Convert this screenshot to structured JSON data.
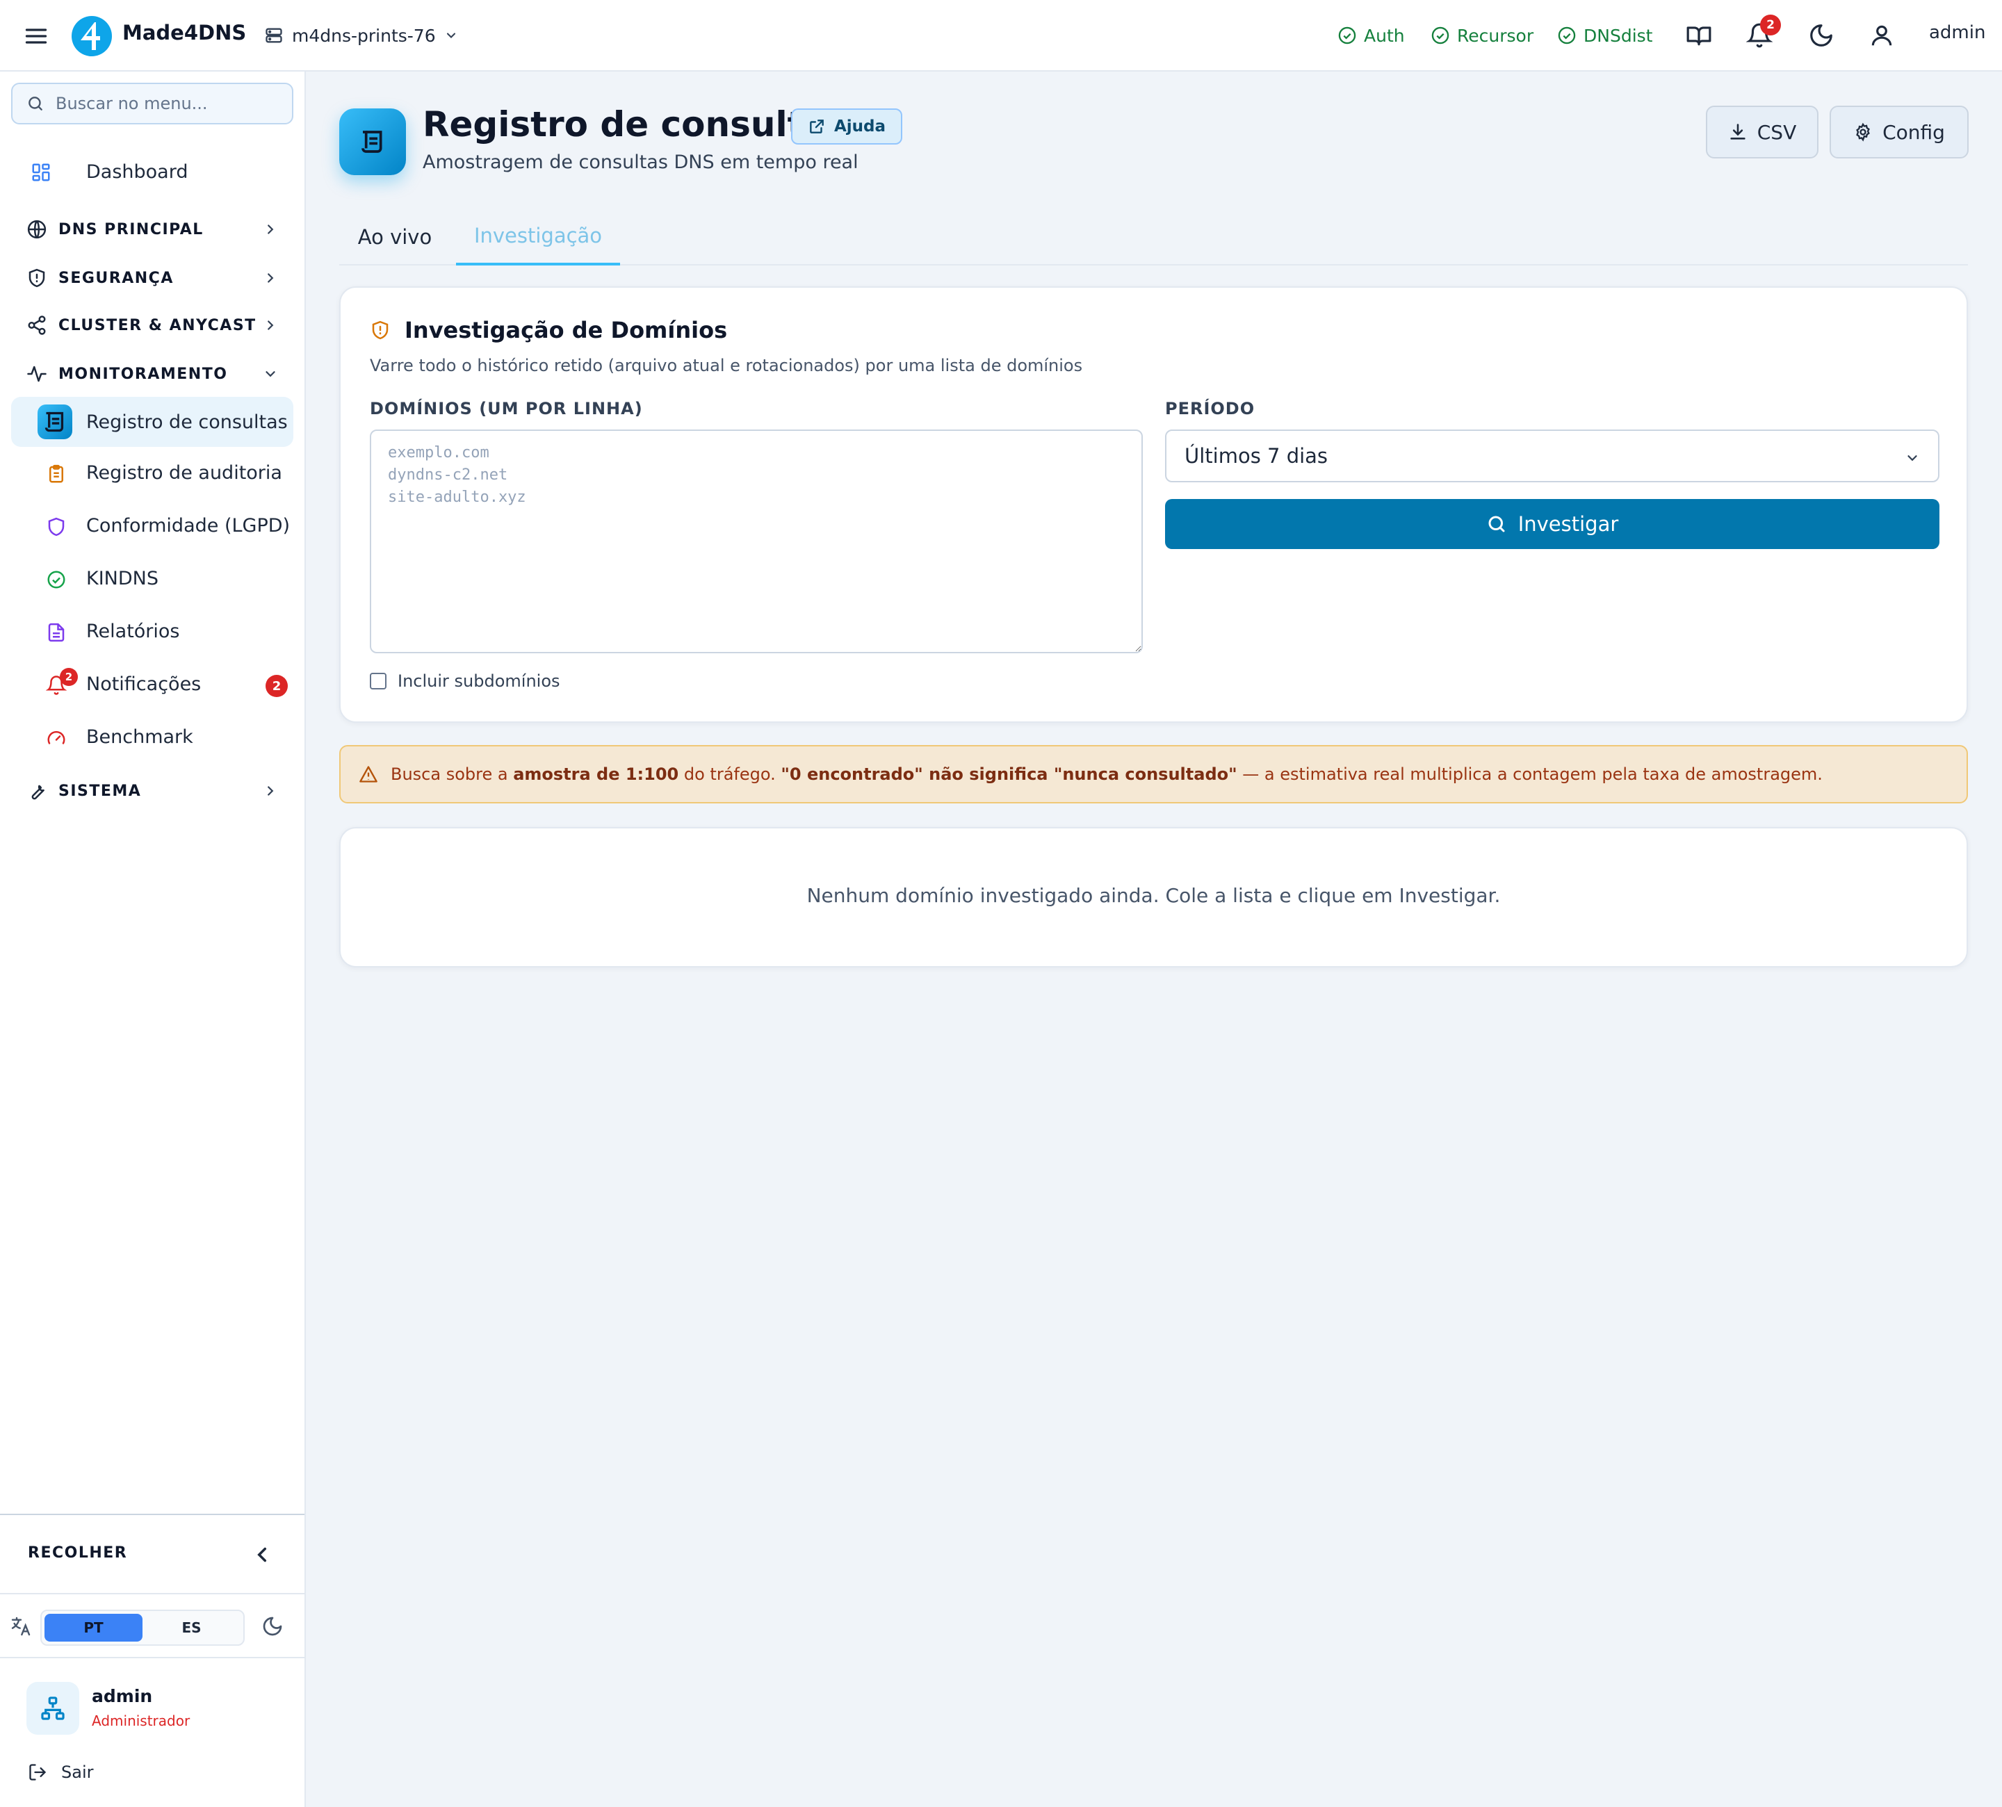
{
  "header": {
    "brand": "Made4DNS",
    "server": "m4dns-prints-76",
    "statuses": [
      {
        "label": "Auth"
      },
      {
        "label": "Recursor"
      },
      {
        "label": "DNSdist"
      }
    ],
    "notifications_count": "2",
    "user": "admin"
  },
  "sidebar": {
    "search_placeholder": "Buscar no menu...",
    "dashboard": "Dashboard",
    "sections": {
      "dns": "DNS PRINCIPAL",
      "security": "SEGURANÇA",
      "cluster": "CLUSTER & ANYCAST",
      "monitoring": "MONITORAMENTO",
      "system": "SISTEMA"
    },
    "monitoring_items": [
      {
        "label": "Registro de consultas"
      },
      {
        "label": "Registro de auditoria"
      },
      {
        "label": "Conformidade (LGPD)"
      },
      {
        "label": "KINDNS"
      },
      {
        "label": "Relatórios"
      },
      {
        "label": "Notificações",
        "badge": "2"
      },
      {
        "label": "Benchmark"
      }
    ],
    "collapse_label": "RECOLHER",
    "languages": [
      "PT",
      "ES"
    ],
    "user": {
      "name": "admin",
      "role": "Administrador"
    },
    "logout": "Sair"
  },
  "page": {
    "title": "Registro de consultas",
    "help": "Ajuda",
    "subtitle": "Amostragem de consultas DNS em tempo real",
    "csv": "CSV",
    "config": "Config",
    "tabs": [
      "Ao vivo",
      "Investigação"
    ],
    "active_tab": "Investigação"
  },
  "investigation": {
    "title": "Investigação de Domínios",
    "description": "Varre todo o histórico retido (arquivo atual e rotacionados) por uma lista de domínios",
    "domains_label": "DOMÍNIOS (UM POR LINHA)",
    "domains_placeholder": "exemplo.com\ndyndns-c2.net\nsite-adulto.xyz",
    "domains_value": "",
    "period_label": "PERÍODO",
    "period_value": "Últimos 7 dias",
    "submit": "Investigar",
    "subdomains_label": "Incluir subdomínios",
    "subdomains_checked": false
  },
  "alert": {
    "pre": "Busca sobre a ",
    "sample": "amostra de 1:100",
    "mid": " do tráfego. ",
    "emphasis": "\"0 encontrado\" não significa \"nunca consultado\"",
    "post": " — a estimativa real multiplica a contagem pela taxa de amostragem."
  },
  "empty_state": "Nenhum domínio investigado ainda. Cole a lista e clique em Investigar.",
  "colors": {
    "primary": "#0277ad",
    "accent": "#38bdf8",
    "success": "#15803d",
    "danger": "#dc2626",
    "warning_bg": "#f5e8d4"
  }
}
